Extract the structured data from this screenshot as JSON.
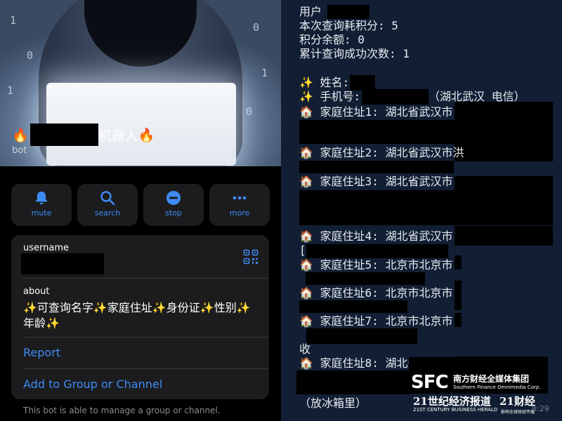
{
  "profile": {
    "title_suffix": "机器人",
    "fire_emoji": "🔥",
    "subtitle": "bot"
  },
  "actions": [
    {
      "label": "mute",
      "icon": "bell-icon"
    },
    {
      "label": "search",
      "icon": "search-icon"
    },
    {
      "label": "stop",
      "icon": "stop-icon"
    },
    {
      "label": "more",
      "icon": "more-icon"
    }
  ],
  "info": {
    "username_label": "username",
    "about_label": "about",
    "about_text": "✨可查询名字✨家庭住址✨身份证✨性别✨年龄✨",
    "report_label": "Report",
    "add_label": "Add to Group or Channel",
    "footnote": "This bot is able to manage a group or channel."
  },
  "message": {
    "user_label": "用户",
    "cost_line": "本次查询耗积分: 5",
    "balance_line": "积分余额: 0",
    "success_line": "累计查询成功次数: 1",
    "name_label": "✨ 姓名:",
    "phone_label": "✨ 手机号:",
    "phone_location": "（湖北武汉 电信）",
    "addresses": [
      "🏠 家庭住址1: 湖北省武汉市",
      "🏠 家庭住址2: 湖北省武汉市洪",
      "🏠 家庭住址3: 湖北省武汉市",
      "🏠 家庭住址4: 湖北省武汉市",
      "🏠 家庭住址5: 北京市北京市",
      "🏠 家庭住址6: 北京市北京市",
      "🏠 家庭住址7: 北京市北京市",
      "🏠 家庭住址8: 湖北省武汉市"
    ],
    "frag_1": "[",
    "frag_2": "收",
    "frag_3": "（放冰箱里）",
    "time": "8:29"
  },
  "watermark": {
    "sfc": "SFC",
    "cn": "南方财经全媒体集团",
    "en": "Southern Finance Omnimedia Corp.",
    "paper": "21世纪经济报道",
    "paper2": "21财经",
    "herald": "21ST CENTURY BUSINESS HERALD",
    "sub": "影响全球财经传播"
  },
  "colors": {
    "accent": "#3e8bf4",
    "card_bg": "#1c1c1e",
    "chat_bg": "#111e33"
  }
}
